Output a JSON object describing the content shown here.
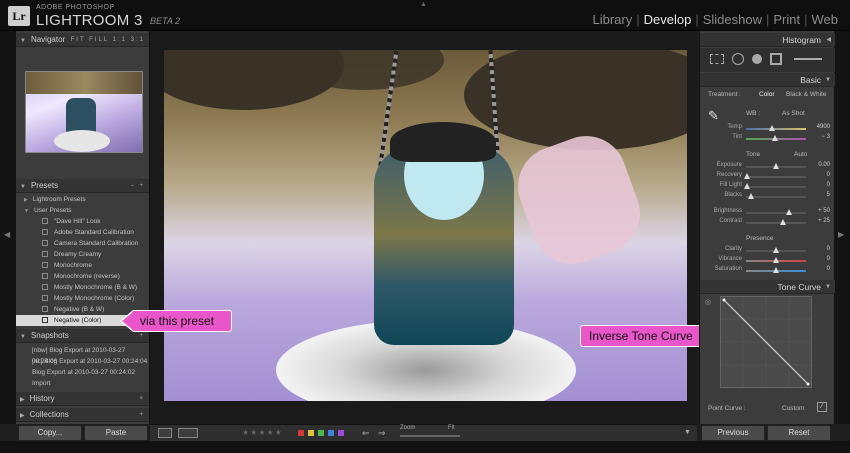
{
  "app": {
    "logo": "Lr",
    "brand_small": "ADOBE PHOTOSHOP",
    "brand": "LIGHTROOM 3",
    "beta": "BETA 2"
  },
  "modules": [
    "Library",
    "Develop",
    "Slideshow",
    "Print",
    "Web"
  ],
  "active_module": "Develop",
  "navigator": {
    "title": "Navigator",
    "zoom_options": [
      "FIT",
      "FILL",
      "1:1",
      "3:1"
    ]
  },
  "presets": {
    "title": "Presets",
    "folders": [
      "Lightroom Presets",
      "User Presets"
    ],
    "items": [
      "\"Dave Hill\" Look",
      "Adobe Standard Calibration",
      "Camera Standard Calibration",
      "Dreamy Creamy",
      "Monochrome",
      "Monochrome (reverse)",
      "Mostly Monochrome (B & W)",
      "Mostly Monochrome (Color)",
      "Negative (B & W)",
      "Negative (Color)"
    ],
    "selected": "Negative (Color)"
  },
  "snapshots": {
    "title": "Snapshots",
    "items": [
      "[nbw] Blog Export at 2010-03-27 00:24:06",
      "[nc] Blog Export at 2010-03-27 00:24:04",
      "Blog Export at 2010-03-27 00:24:02",
      "Import"
    ]
  },
  "history": {
    "title": "History"
  },
  "collections": {
    "title": "Collections"
  },
  "left_buttons": {
    "copy": "Copy...",
    "paste": "Paste"
  },
  "right_buttons": {
    "previous": "Previous",
    "reset": "Reset"
  },
  "callouts": {
    "left": "via this preset",
    "right": "Inverse Tone Curve"
  },
  "toolbar": {
    "zoom_label": "Zoom",
    "fit_label": "Fit",
    "stars": "★★★★★",
    "flag_colors": [
      "#d33a3a",
      "#d9c43a",
      "#4cb94c",
      "#3a84d9",
      "#9b4cd9"
    ]
  },
  "histogram": {
    "title": "Histogram"
  },
  "basic": {
    "title": "Basic",
    "treatment_label": "Treatment :",
    "treatment_color": "Color",
    "treatment_bw": "Black & White",
    "wb_label": "WB :",
    "wb_value": "As Shot",
    "temp": {
      "label": "Temp",
      "value": "4900",
      "pos": 0.42
    },
    "tint": {
      "label": "Tint",
      "value": "− 3",
      "pos": 0.48
    },
    "tone_label": "Tone",
    "tone_auto": "Auto",
    "exposure": {
      "label": "Exposure",
      "value": "0.00",
      "pos": 0.5
    },
    "recovery": {
      "label": "Recovery",
      "value": "0",
      "pos": 0.02
    },
    "fill_light": {
      "label": "Fill Light",
      "value": "0",
      "pos": 0.02
    },
    "blacks": {
      "label": "Blacks",
      "value": "5",
      "pos": 0.08
    },
    "brightness": {
      "label": "Brightness",
      "value": "+ 50",
      "pos": 0.72
    },
    "contrast": {
      "label": "Contrast",
      "value": "+ 25",
      "pos": 0.62
    },
    "presence_label": "Presence",
    "clarity": {
      "label": "Clarity",
      "value": "0",
      "pos": 0.5
    },
    "vibrance": {
      "label": "Vibrance",
      "value": "0",
      "pos": 0.5
    },
    "saturation": {
      "label": "Saturation",
      "value": "0",
      "pos": 0.5
    }
  },
  "tone_curve": {
    "title": "Tone Curve",
    "point_curve_label": "Point Curve :",
    "point_curve_value": "Custom"
  }
}
